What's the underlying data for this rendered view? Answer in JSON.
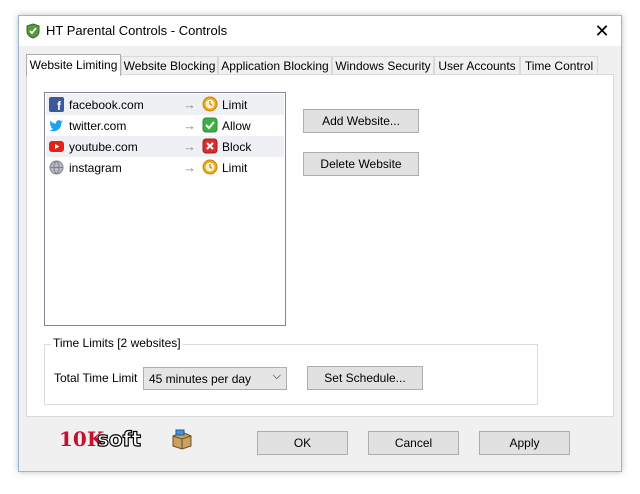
{
  "window": {
    "title": "HT Parental Controls - Controls",
    "close_glyph": "✕"
  },
  "tabs": [
    {
      "label": "Website Limiting"
    },
    {
      "label": "Website Blocking"
    },
    {
      "label": "Application Blocking"
    },
    {
      "label": "Windows Security"
    },
    {
      "label": "User Accounts"
    },
    {
      "label": "Time Control"
    }
  ],
  "websites": [
    {
      "name": "facebook.com",
      "icon": "facebook-icon",
      "arrow": "→",
      "status": "Limit",
      "status_icon": "limit-clock-icon"
    },
    {
      "name": "twitter.com",
      "icon": "twitter-icon",
      "arrow": "→",
      "status": "Allow",
      "status_icon": "allow-check-icon"
    },
    {
      "name": "youtube.com",
      "icon": "youtube-icon",
      "arrow": "→",
      "status": "Block",
      "status_icon": "block-x-icon"
    },
    {
      "name": "instagram",
      "icon": "globe-icon",
      "arrow": "→",
      "status": "Limit",
      "status_icon": "limit-clock-icon"
    }
  ],
  "buttons": {
    "add_website": "Add Website...",
    "delete_website": "Delete Website",
    "set_schedule": "Set Schedule...",
    "ok": "OK",
    "cancel": "Cancel",
    "apply": "Apply"
  },
  "time_limits": {
    "group_title": "Time Limits [2 websites]",
    "total_label": "Total Time Limit",
    "selected": "45 minutes per day"
  },
  "logo": {
    "text_red": "10K",
    "text_rest": "soft"
  },
  "colors": {
    "facebook": "#3b5998",
    "twitter": "#1da1f2",
    "youtube": "#e62117",
    "allow": "#3cb043",
    "block": "#d32f2f",
    "limit": "#f0a81c"
  }
}
